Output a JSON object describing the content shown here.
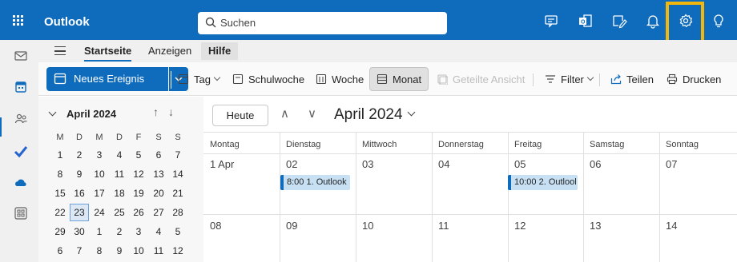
{
  "app": {
    "title": "Outlook"
  },
  "search": {
    "placeholder": "Suchen"
  },
  "tabs": [
    {
      "label": "Startseite"
    },
    {
      "label": "Anzeigen"
    },
    {
      "label": "Hilfe"
    }
  ],
  "ribbon": {
    "new_event": "Neues Ereignis",
    "day": "Tag",
    "work_week": "Schulwoche",
    "week": "Woche",
    "month": "Monat",
    "shared_view": "Geteilte Ansicht",
    "filter": "Filter",
    "share": "Teilen",
    "print": "Drucken"
  },
  "mini_calendar": {
    "title": "April 2024",
    "weekdays": [
      "M",
      "D",
      "M",
      "D",
      "F",
      "S",
      "S"
    ],
    "weeks": [
      [
        "1",
        "2",
        "3",
        "4",
        "5",
        "6",
        "7"
      ],
      [
        "8",
        "9",
        "10",
        "11",
        "12",
        "13",
        "14"
      ],
      [
        "15",
        "16",
        "17",
        "18",
        "19",
        "20",
        "21"
      ],
      [
        "22",
        "23",
        "24",
        "25",
        "26",
        "27",
        "28"
      ],
      [
        "29",
        "30",
        "1",
        "2",
        "3",
        "4",
        "5"
      ],
      [
        "6",
        "7",
        "8",
        "9",
        "10",
        "11",
        "12"
      ]
    ],
    "today": "23"
  },
  "calendar": {
    "today_button": "Heute",
    "title": "April 2024",
    "day_headers": [
      "Montag",
      "Dienstag",
      "Mittwoch",
      "Donnerstag",
      "Freitag",
      "Samstag",
      "Sonntag"
    ],
    "week1_dates": [
      "1 Apr",
      "02",
      "03",
      "04",
      "05",
      "06",
      "07"
    ],
    "week2_dates": [
      "08",
      "09",
      "10",
      "11",
      "12",
      "13",
      "14"
    ],
    "events": [
      {
        "label": "8:00 1. Outlook"
      },
      {
        "label": "10:00 2. Outlool"
      }
    ]
  },
  "colors": {
    "brand": "#0f6cbd",
    "highlight": "#f2b70a",
    "event_bg": "#c7e0f4"
  }
}
